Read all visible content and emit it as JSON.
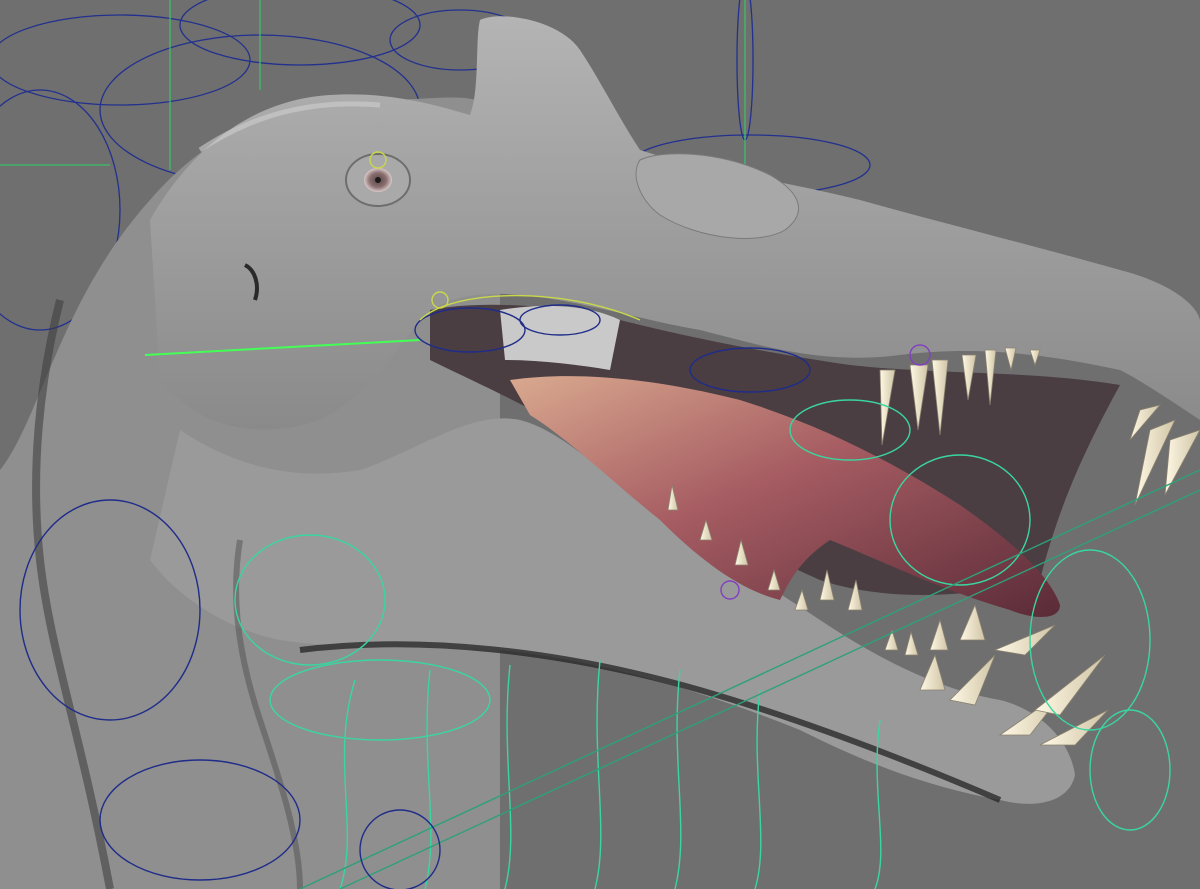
{
  "viewport": {
    "background": "#6f6f6f",
    "skin_color": "#9d9d9d",
    "skin_highlight": "#bcbcbc",
    "skin_shadow": "#2a2a2a",
    "mouth_interior": "#c7c7c7",
    "tongue_base": "#d6a590",
    "tongue_mid": "#a45a60",
    "tongue_tip": "#5d2e3a",
    "teeth_color": "#efe7d0",
    "rig_colors": {
      "blue_controls": "#1f2c8a",
      "green_controls": "#3ad6a0",
      "bright_green": "#44ff55",
      "yellow_controls": "#c9d84a",
      "purple_controls": "#8040c0"
    }
  }
}
